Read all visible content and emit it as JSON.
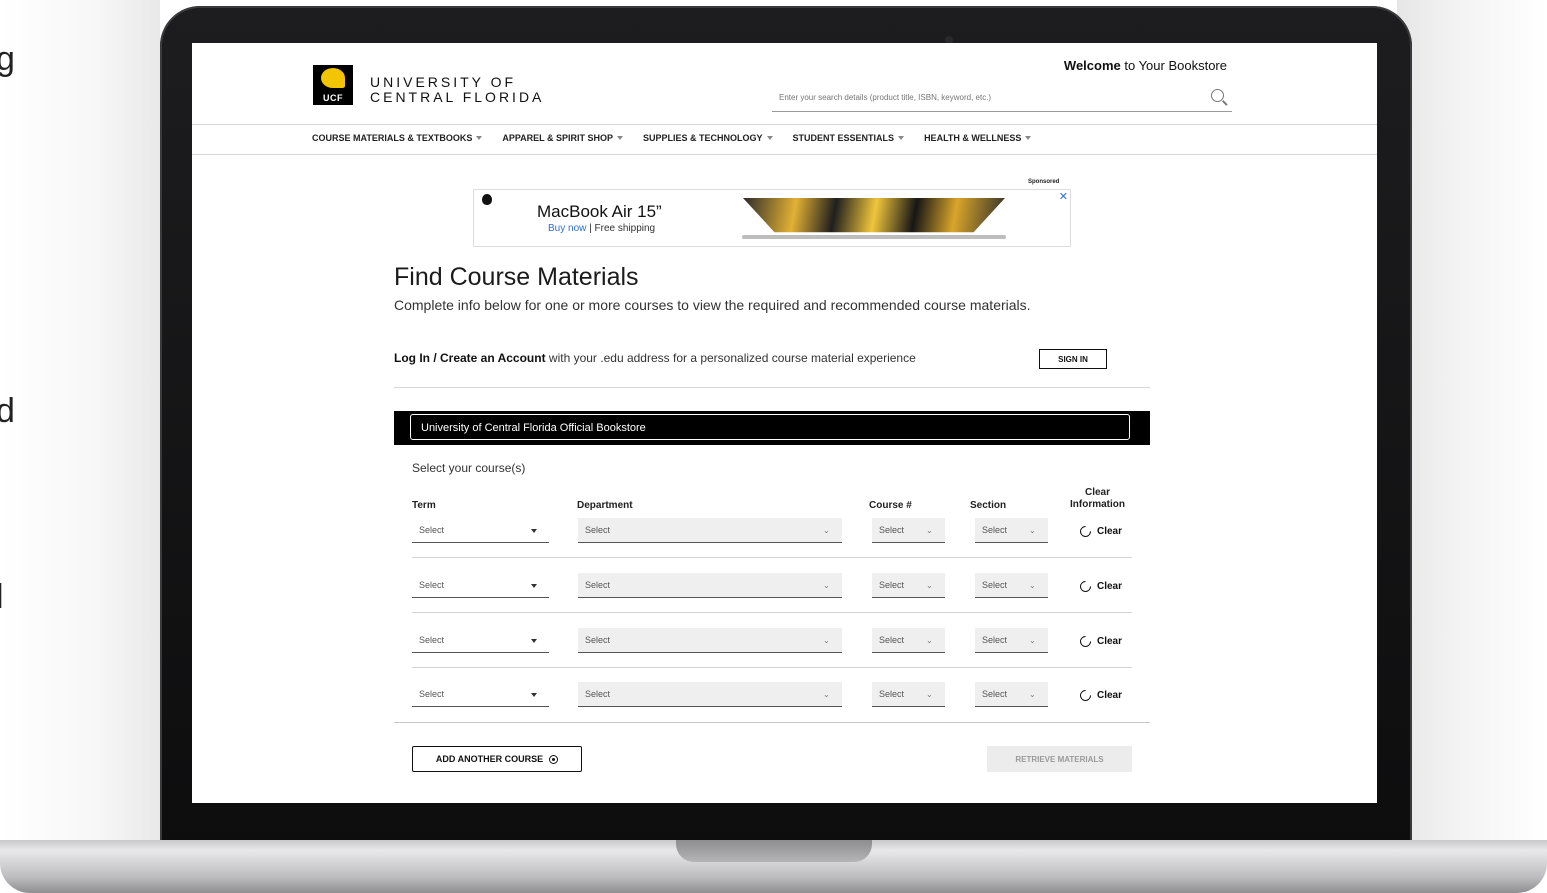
{
  "edge_letters": [
    "g",
    "d",
    "l"
  ],
  "header": {
    "logo_abbr": "UCF",
    "logo_line1": "UNIVERSITY OF",
    "logo_line2": "CENTRAL FLORIDA",
    "welcome_bold": "Welcome",
    "welcome_rest": " to Your Bookstore",
    "search_placeholder": "Enter your search details (product title, ISBN, keyword, etc.)"
  },
  "nav": {
    "items": [
      {
        "label": "COURSE MATERIALS & TEXTBOOKS"
      },
      {
        "label": "APPAREL & SPIRIT SHOP"
      },
      {
        "label": "SUPPLIES & TECHNOLOGY"
      },
      {
        "label": "STUDENT ESSENTIALS"
      },
      {
        "label": "HEALTH & WELLNESS"
      }
    ]
  },
  "ad": {
    "sponsored": "Sponsored",
    "title": "MacBook Air 15”",
    "buy_now": "Buy now",
    "separator": " | ",
    "shipping": "Free shipping",
    "close": "✕"
  },
  "main": {
    "title": "Find Course Materials",
    "description": "Complete info below for one or more courses to view the required and recommended course materials.",
    "login_bold": "Log In / Create an Account",
    "login_rest": " with your .edu address for a personalized course material experience",
    "signin_label": "SIGN IN",
    "store_name": "University of Central Florida Official Bookstore",
    "select_courses": "Select your course(s)"
  },
  "table": {
    "headers": {
      "term": "Term",
      "department": "Department",
      "course": "Course #",
      "section": "Section",
      "clear_line1": "Clear",
      "clear_line2": "Information"
    },
    "rows": [
      {
        "term": "Select",
        "department": "Select",
        "course": "Select",
        "section": "Select",
        "clear": "Clear"
      },
      {
        "term": "Select",
        "department": "Select",
        "course": "Select",
        "section": "Select",
        "clear": "Clear"
      },
      {
        "term": "Select",
        "department": "Select",
        "course": "Select",
        "section": "Select",
        "clear": "Clear"
      },
      {
        "term": "Select",
        "department": "Select",
        "course": "Select",
        "section": "Select",
        "clear": "Clear"
      }
    ]
  },
  "actions": {
    "add_course": "ADD ANOTHER COURSE",
    "retrieve": "RETRIEVE MATERIALS"
  },
  "colors": {
    "ucf_gold": "#f2c500",
    "link_blue": "#2f6fd6",
    "store_bar": "#000000"
  }
}
